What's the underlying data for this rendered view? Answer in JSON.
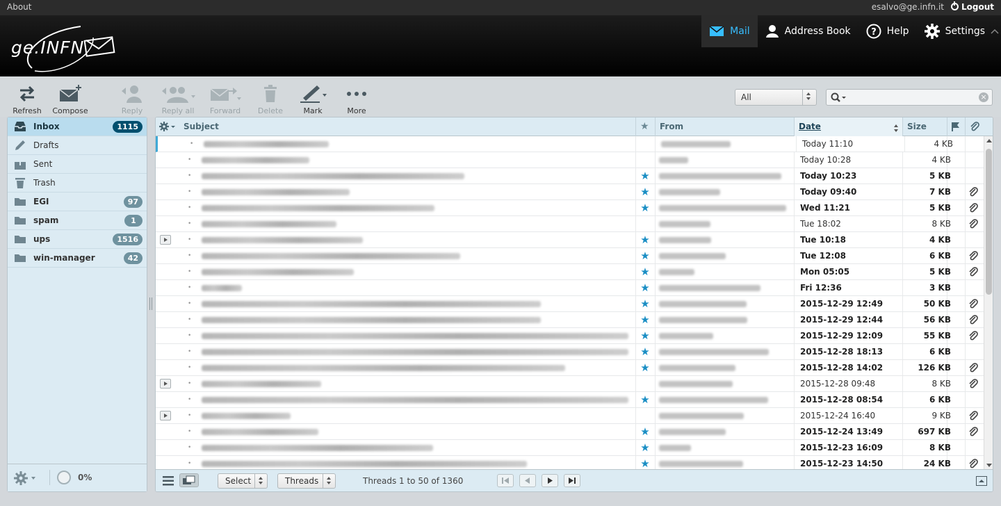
{
  "topbar": {
    "about": "About",
    "user": "esalvo@ge.infn.it",
    "logout": "Logout"
  },
  "logo": {
    "text_a": "ge.INF",
    "text_b": "N"
  },
  "nav": [
    {
      "label": "Mail",
      "icon": "mail-icon",
      "active": true
    },
    {
      "label": "Address Book",
      "icon": "person-icon"
    },
    {
      "label": "Help",
      "icon": "help-icon"
    },
    {
      "label": "Settings",
      "icon": "gear-icon"
    }
  ],
  "toolbar": {
    "refresh": "Refresh",
    "compose": "Compose",
    "reply": "Reply",
    "reply_all": "Reply all",
    "forward": "Forward",
    "delete": "Delete",
    "mark": "Mark",
    "more": "More"
  },
  "filter": {
    "value": "All"
  },
  "folders": [
    {
      "name": "Inbox",
      "count": "1115",
      "icon": "inbox-icon",
      "selected": true
    },
    {
      "name": "Drafts",
      "count": "",
      "icon": "pencil-icon"
    },
    {
      "name": "Sent",
      "count": "",
      "icon": "sent-icon"
    },
    {
      "name": "Trash",
      "count": "",
      "icon": "trash-icon"
    },
    {
      "name": "EGI",
      "count": "97",
      "icon": "folder-icon",
      "bold": true
    },
    {
      "name": "spam",
      "count": "1",
      "icon": "folder-icon",
      "bold": true
    },
    {
      "name": "ups",
      "count": "1516",
      "icon": "folder-icon",
      "bold": true
    },
    {
      "name": "win-manager",
      "count": "42",
      "icon": "folder-icon",
      "bold": true
    }
  ],
  "quota": "0%",
  "list_headers": {
    "subject": "Subject",
    "from": "From",
    "date": "Date",
    "size": "Size"
  },
  "messages": [
    {
      "date": "Today 11:10",
      "size": "4 KB",
      "star": false,
      "att": false,
      "unread": false,
      "thread": false,
      "subj_w": 180,
      "from_w": 100
    },
    {
      "date": "Today 10:28",
      "size": "4 KB",
      "star": false,
      "att": false,
      "unread": false,
      "thread": false,
      "subj_w": 155,
      "from_w": 42
    },
    {
      "date": "Today 10:23",
      "size": "5 KB",
      "star": true,
      "att": false,
      "unread": true,
      "thread": false,
      "subj_w": 378,
      "from_w": 176
    },
    {
      "date": "Today 09:40",
      "size": "7 KB",
      "star": true,
      "att": true,
      "unread": true,
      "thread": false,
      "subj_w": 213,
      "from_w": 88
    },
    {
      "date": "Wed 11:21",
      "size": "5 KB",
      "star": true,
      "att": true,
      "unread": true,
      "thread": false,
      "subj_w": 335,
      "from_w": 183
    },
    {
      "date": "Tue 18:02",
      "size": "8 KB",
      "star": false,
      "att": true,
      "unread": false,
      "thread": false,
      "subj_w": 194,
      "from_w": 74
    },
    {
      "date": "Tue 10:18",
      "size": "4 KB",
      "star": true,
      "att": false,
      "unread": true,
      "thread": true,
      "subj_w": 232,
      "from_w": 75
    },
    {
      "date": "Tue 12:08",
      "size": "6 KB",
      "star": true,
      "att": true,
      "unread": true,
      "thread": false,
      "subj_w": 372,
      "from_w": 96
    },
    {
      "date": "Mon 05:05",
      "size": "5 KB",
      "star": true,
      "att": true,
      "unread": true,
      "thread": false,
      "subj_w": 219,
      "from_w": 51
    },
    {
      "date": "Fri 12:36",
      "size": "3 KB",
      "star": true,
      "att": false,
      "unread": true,
      "thread": false,
      "subj_w": 58,
      "from_w": 146
    },
    {
      "date": "2015-12-29 12:49",
      "size": "50 KB",
      "star": true,
      "att": true,
      "unread": true,
      "thread": false,
      "subj_w": 488,
      "from_w": 126
    },
    {
      "date": "2015-12-29 12:44",
      "size": "56 KB",
      "star": true,
      "att": true,
      "unread": true,
      "thread": false,
      "subj_w": 488,
      "from_w": 127
    },
    {
      "date": "2015-12-29 12:09",
      "size": "55 KB",
      "star": true,
      "att": true,
      "unread": true,
      "thread": false,
      "subj_w": 614,
      "from_w": 78
    },
    {
      "date": "2015-12-28 18:13",
      "size": "6 KB",
      "star": true,
      "att": false,
      "unread": true,
      "thread": false,
      "subj_w": 614,
      "from_w": 158
    },
    {
      "date": "2015-12-28 14:02",
      "size": "126 KB",
      "star": true,
      "att": true,
      "unread": true,
      "thread": false,
      "subj_w": 523,
      "from_w": 110
    },
    {
      "date": "2015-12-28 09:48",
      "size": "8 KB",
      "star": false,
      "att": true,
      "unread": false,
      "thread": true,
      "subj_w": 172,
      "from_w": 106
    },
    {
      "date": "2015-12-28 08:54",
      "size": "6 KB",
      "star": true,
      "att": false,
      "unread": true,
      "thread": false,
      "subj_w": 614,
      "from_w": 157
    },
    {
      "date": "2015-12-24 16:40",
      "size": "9 KB",
      "star": false,
      "att": true,
      "unread": false,
      "thread": true,
      "subj_w": 128,
      "from_w": 122
    },
    {
      "date": "2015-12-24 13:49",
      "size": "697 KB",
      "star": true,
      "att": true,
      "unread": true,
      "thread": false,
      "subj_w": 168,
      "from_w": 96
    },
    {
      "date": "2015-12-23 16:09",
      "size": "8 KB",
      "star": true,
      "att": false,
      "unread": true,
      "thread": false,
      "subj_w": 333,
      "from_w": 46
    },
    {
      "date": "2015-12-23 14:50",
      "size": "24 KB",
      "star": true,
      "att": true,
      "unread": true,
      "thread": false,
      "subj_w": 468,
      "from_w": 121
    }
  ],
  "footer": {
    "select": "Select",
    "threads": "Threads",
    "count": "Threads 1 to 50 of 1360"
  }
}
